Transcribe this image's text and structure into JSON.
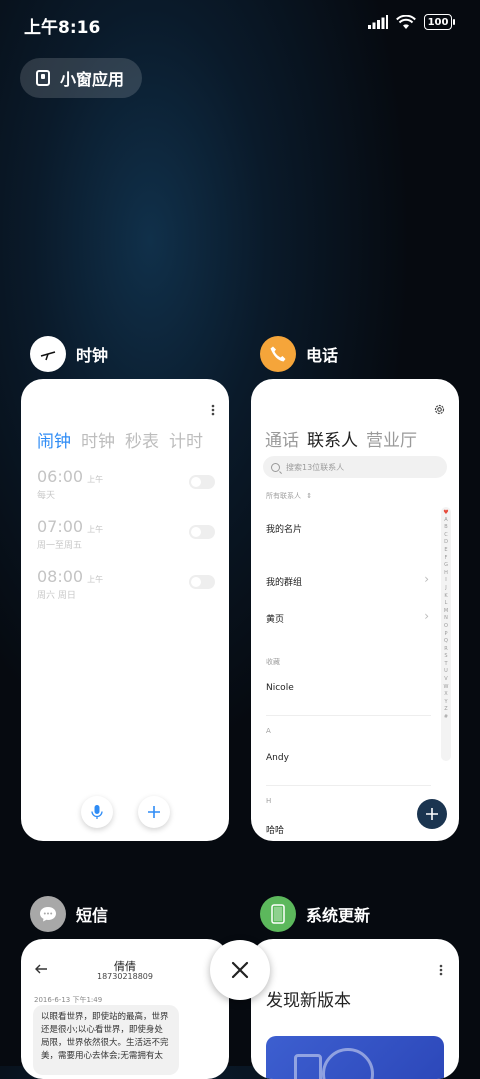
{
  "status": {
    "time": "上午8:16",
    "battery": "100"
  },
  "small_window": {
    "label": "小窗应用"
  },
  "clock": {
    "app_name": "时钟",
    "tabs": [
      "闹钟",
      "时钟",
      "秒表",
      "计时"
    ],
    "alarms": [
      {
        "time": "06:00",
        "ampm": "上午",
        "repeat": "每天"
      },
      {
        "time": "07:00",
        "ampm": "上午",
        "repeat": "周一至周五"
      },
      {
        "time": "08:00",
        "ampm": "上午",
        "repeat": "周六 周日"
      }
    ]
  },
  "phone": {
    "app_name": "电话",
    "tabs": [
      "通话",
      "联系人",
      "营业厅"
    ],
    "search_placeholder": "搜索13位联系人",
    "all_contacts": "所有联系人",
    "my_card": "我的名片",
    "my_groups": "我的群组",
    "yellow_pages": "黄页",
    "favorites_label": "收藏",
    "favorite": "Nicole",
    "section_a": "A",
    "contact_a": "Andy",
    "section_h": "H",
    "contact_h": "哈哈",
    "alphabet": [
      "A",
      "B",
      "C",
      "D",
      "E",
      "F",
      "G",
      "H",
      "I",
      "J",
      "K",
      "L",
      "M",
      "N",
      "O",
      "P",
      "Q",
      "R",
      "S",
      "T",
      "U",
      "V",
      "W",
      "X",
      "Y",
      "Z",
      "#"
    ]
  },
  "sms": {
    "app_name": "短信",
    "contact_name": "倩倩",
    "contact_number": "18730218809",
    "timestamp": "2016-6-13 下午1:49",
    "message": "以眼看世界，即使站的最高，世界还是很小;以心看世界，即使身处局限，世界依然很大。生活远不完美，需要用心去体会;无需拥有太"
  },
  "update": {
    "app_name": "系统更新",
    "headline": "发现新版本"
  },
  "colors": {
    "accent_blue": "#2f8cf5",
    "phone_orange": "#f5a53a",
    "update_green": "#5cb85c",
    "fab_dark": "#1b3550"
  }
}
